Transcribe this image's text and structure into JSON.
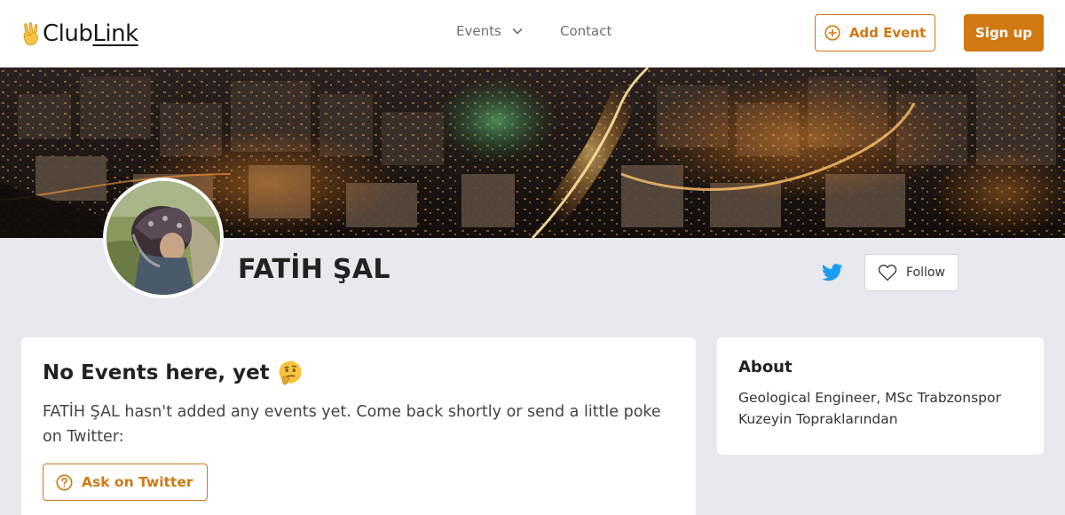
{
  "nav": {
    "logo_emoji_name": "victory-hand-icon",
    "logo_text_club": "Club",
    "logo_text_link": "Link",
    "events_label": "Events",
    "contact_label": "Contact",
    "add_event_label": "Add Event",
    "signup_label": "Sign up"
  },
  "colors": {
    "accent": "#d07812",
    "page_bg": "#e8e9ee",
    "twitter": "#1d9bf0"
  },
  "profile": {
    "name": "FATİH ŞAL",
    "follow_label": "Follow"
  },
  "events": {
    "title": "No Events here, yet",
    "emoji_name": "thinking-face-icon",
    "description": "FATİH ŞAL hasn't added any events yet. Come back shortly or send a little poke on Twitter:",
    "ask_button_label": "Ask on Twitter"
  },
  "about": {
    "title": "About",
    "text": "Geological Engineer, MSc Trabzonspor Kuzeyin Topraklarından"
  }
}
